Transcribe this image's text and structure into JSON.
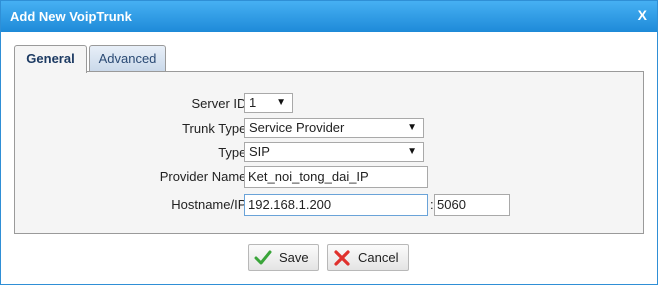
{
  "dialog": {
    "title": "Add New VoipTrunk",
    "close_label": "X"
  },
  "tabs": [
    {
      "label": "General",
      "active": true
    },
    {
      "label": "Advanced",
      "active": false
    }
  ],
  "form": {
    "server_id": {
      "label": "Server ID:",
      "value": "1"
    },
    "trunk_type": {
      "label": "Trunk Type:",
      "value": "Service Provider"
    },
    "type": {
      "label": "Type:",
      "value": "SIP"
    },
    "provider_name": {
      "label": "Provider Name:",
      "value": "Ket_noi_tong_dai_IP"
    },
    "hostname": {
      "label": "Hostname/IP:",
      "value": "192.168.1.200",
      "separator": ":",
      "port": "5060"
    }
  },
  "buttons": {
    "save": {
      "label": "Save",
      "icon": "checkmark-icon"
    },
    "cancel": {
      "label": "Cancel",
      "icon": "x-icon"
    }
  },
  "colors": {
    "titlebar": "#1e8ad8",
    "save_icon": "#3aa53a",
    "cancel_icon": "#e0312d"
  }
}
